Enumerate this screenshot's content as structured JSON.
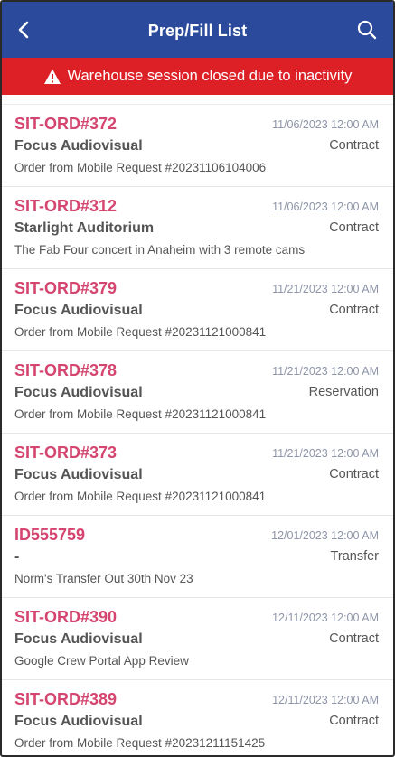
{
  "header": {
    "title": "Prep/Fill List",
    "back_icon": "chevron-left-icon",
    "search_icon": "search-icon"
  },
  "alert": {
    "text": "Warehouse session closed due to inactivity",
    "icon": "warning-icon"
  },
  "colors": {
    "header_bg": "#2b4a9c",
    "alert_bg": "#dd1f26",
    "order_id": "#d4456f",
    "date": "#8e95a8"
  },
  "orders": [
    {
      "id": "SIT-ORD#372",
      "date": "11/06/2023 12:00 AM",
      "customer": "Focus Audiovisual",
      "type": "Contract",
      "description": "Order from Mobile Request #20231106104006"
    },
    {
      "id": "SIT-ORD#312",
      "date": "11/06/2023 12:00 AM",
      "customer": "Starlight Auditorium",
      "type": "Contract",
      "description": "The Fab Four concert in Anaheim with 3 remote cams"
    },
    {
      "id": "SIT-ORD#379",
      "date": "11/21/2023 12:00 AM",
      "customer": "Focus Audiovisual",
      "type": "Contract",
      "description": "Order from Mobile Request #20231121000841"
    },
    {
      "id": "SIT-ORD#378",
      "date": "11/21/2023 12:00 AM",
      "customer": "Focus Audiovisual",
      "type": "Reservation",
      "description": "Order from Mobile Request #20231121000841"
    },
    {
      "id": "SIT-ORD#373",
      "date": "11/21/2023 12:00 AM",
      "customer": "Focus Audiovisual",
      "type": "Contract",
      "description": "Order from Mobile Request #20231121000841"
    },
    {
      "id": "ID555759",
      "date": "12/01/2023 12:00 AM",
      "customer": "-",
      "type": "Transfer",
      "description": "Norm's Transfer Out 30th Nov 23"
    },
    {
      "id": "SIT-ORD#390",
      "date": "12/11/2023 12:00 AM",
      "customer": "Focus Audiovisual",
      "type": "Contract",
      "description": "Google Crew Portal App Review"
    },
    {
      "id": "SIT-ORD#389",
      "date": "12/11/2023 12:00 AM",
      "customer": "Focus Audiovisual",
      "type": "Contract",
      "description": "Order from Mobile Request #20231211151425"
    }
  ]
}
